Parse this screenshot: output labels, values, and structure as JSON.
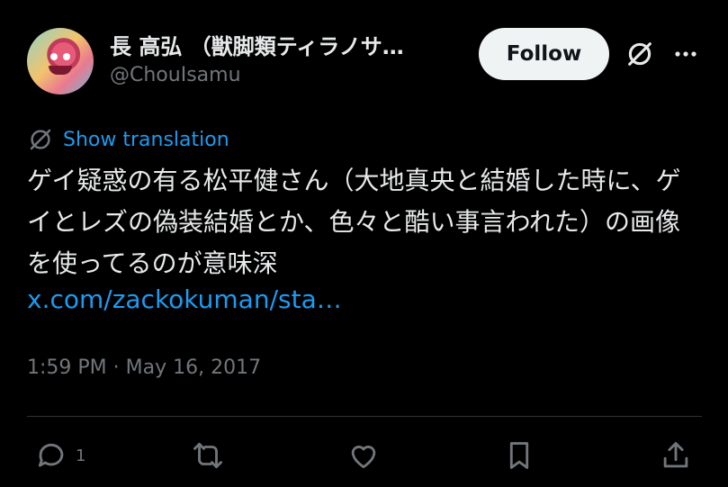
{
  "author": {
    "display_name": "長 高弘 （獣脚類ティラノサ…",
    "handle": "@ChouIsamu",
    "avatar_icon": "dragon-avatar-icon"
  },
  "follow_label": "Follow",
  "translate_label": "Show translation",
  "tweet": {
    "text": "ゲイ疑惑の有る松平健さん（大地真央と結婚した時に、ゲイとレズの偽装結婚とか、色々と酷い事言われた）の画像を使ってるのが意味深",
    "link": "x.com/zackokuman/sta…",
    "timestamp": "1:59 PM · May 16, 2017"
  },
  "actions": {
    "reply_count": "1"
  },
  "colors": {
    "background": "#000000",
    "text": "#e7e9ea",
    "secondary": "#71767b",
    "link": "#1d9bf0",
    "follow_bg": "#eff3f4"
  }
}
